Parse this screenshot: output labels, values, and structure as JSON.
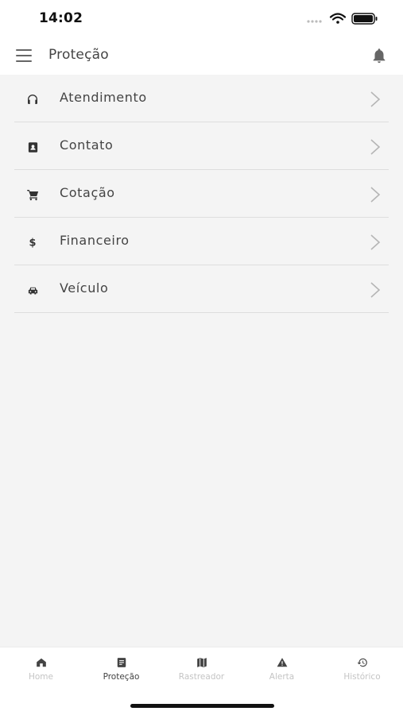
{
  "status_bar": {
    "time": "14:02"
  },
  "header": {
    "title": "Proteção"
  },
  "menu": {
    "items": [
      {
        "label": "Atendimento",
        "icon": "headphones-icon"
      },
      {
        "label": "Contato",
        "icon": "contact-card-icon"
      },
      {
        "label": "Cotação",
        "icon": "cart-icon"
      },
      {
        "label": "Financeiro",
        "icon": "dollar-icon"
      },
      {
        "label": "Veículo",
        "icon": "car-icon"
      }
    ]
  },
  "tabs": [
    {
      "label": "Home",
      "icon": "home-icon",
      "active": false
    },
    {
      "label": "Proteção",
      "icon": "document-icon",
      "active": true
    },
    {
      "label": "Rastreador",
      "icon": "map-icon",
      "active": false
    },
    {
      "label": "Alerta",
      "icon": "warning-icon",
      "active": false
    },
    {
      "label": "Histórico",
      "icon": "history-icon",
      "active": false
    }
  ],
  "colors": {
    "background": "#f4f4f4",
    "active_tab": "#444444",
    "inactive_tab": "#c4c4c4"
  }
}
